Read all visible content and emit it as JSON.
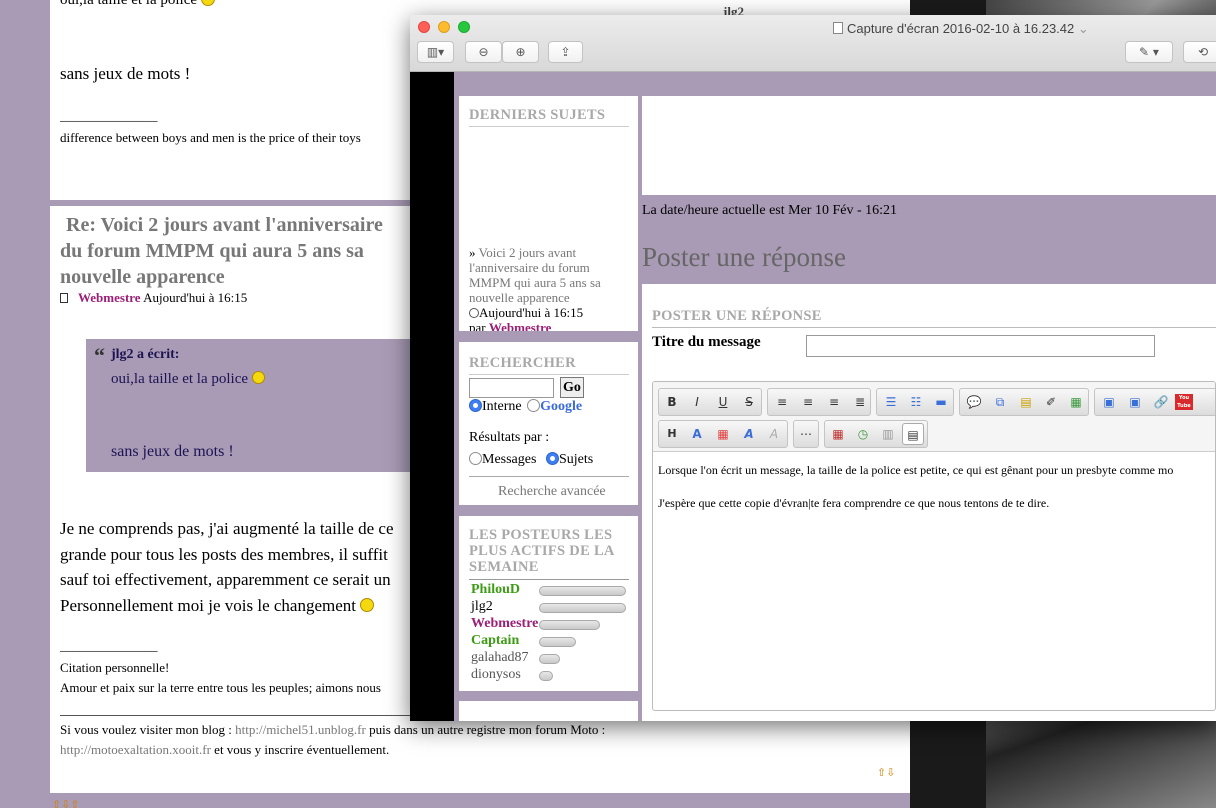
{
  "background_page": {
    "top_line": "oui,la taille et la police",
    "sans_jeux": "sans jeux de mots !",
    "separator": "_______________",
    "sig1": "difference between boys and men is the price of their toys",
    "post_title_1": "Re: Voici 2 jours avant l'anniversaire",
    "post_title_2": "du forum MMPM qui aura 5 ans sa",
    "post_title_3": "nouvelle apparence",
    "author": "Webmestre",
    "post_time": "Aujourd'hui à 16:15",
    "quote_author": "jlg2 a écrit:",
    "quote_line1": "oui,la taille et la police",
    "quote_line2": "sans jeux de mots !",
    "body1": "Je ne comprends pas, j'ai augmenté la taille de ce",
    "body2": "grande pour tous les posts des membres, il suffit",
    "body3": "sauf toi effectivement, apparemment ce serait un",
    "body4": "Personnellement moi je vois le changement",
    "sig2_sep": "_______________",
    "sig2_line1": "Citation personnelle!",
    "sig2_line2": "Amour et paix sur la terre entre tous les peuples; aimons nous",
    "blog_prefix": "Si  vous voulez visiter mon blog : ",
    "blog_url": "http://michel51.unblog.fr",
    "blog_mid": " puis dans un autre registre mon forum Moto :",
    "moto_url": "http://motoexaltation.xooit.fr",
    "moto_suffix": " et vous y inscrire éventuellement.",
    "right_username": "jlg2"
  },
  "window": {
    "title": "Capture d'écran 2016-02-10 à 16.23.42",
    "title_chevron": "⌄"
  },
  "sidebar": {
    "latest_header": "DERNIERS SUJETS",
    "latest_link_1": "Voici 2 jours avant",
    "latest_link_2": "l'anniversaire du forum",
    "latest_link_3": "MMPM qui aura 5 ans sa",
    "latest_link_4": "nouvelle apparence",
    "latest_time": "Aujourd'hui à 16:15",
    "latest_by": "par",
    "latest_author": "Webmestre",
    "search_header": "RECHERCHER",
    "search_go": "Go",
    "radio_interne": "Interne",
    "radio_google": "Google",
    "results_label": "Résultats par :",
    "radio_messages": "Messages",
    "radio_sujets": "Sujets",
    "advanced_search": "Recherche avancée",
    "posters_header_1": "LES POSTEURS LES",
    "posters_header_2": "PLUS ACTIFS DE LA",
    "posters_header_3": "SEMAINE",
    "posters": [
      {
        "name": "PhilouD",
        "share": 1.0
      },
      {
        "name": "jlg2",
        "share": 1.0
      },
      {
        "name": "Webmestre",
        "share": 0.7
      },
      {
        "name": "Captain",
        "share": 0.43
      },
      {
        "name": "galahad87",
        "share": 0.24
      },
      {
        "name": "dionysos",
        "share": 0.16
      }
    ]
  },
  "main": {
    "datetime": "La date/heure actuelle est Mer 10 Fév - 16:21",
    "page_heading": "Poster une réponse",
    "section_header": "POSTER UNE RÉPONSE",
    "subject_label": "Titre du message",
    "subject_value": "",
    "message_line1": "Lorsque l'on écrit un message, la taille de la police est petite, ce qui est gênant pour un presbyte comme mo",
    "message_line2": "J'espère que cette copie d'évran|te fera comprendre ce que nous tentons de te dire."
  },
  "editor_toolbar": {
    "bold": "B",
    "italic": "I",
    "underline": "U",
    "strike": "S",
    "heading": "H",
    "youtube": "You Tube"
  },
  "colors": {
    "forum_purple": "#a99bb5",
    "author_purple": "#9b1f77",
    "poster_green": "#3c9c14",
    "radio_blue": "#3d7ef2"
  }
}
